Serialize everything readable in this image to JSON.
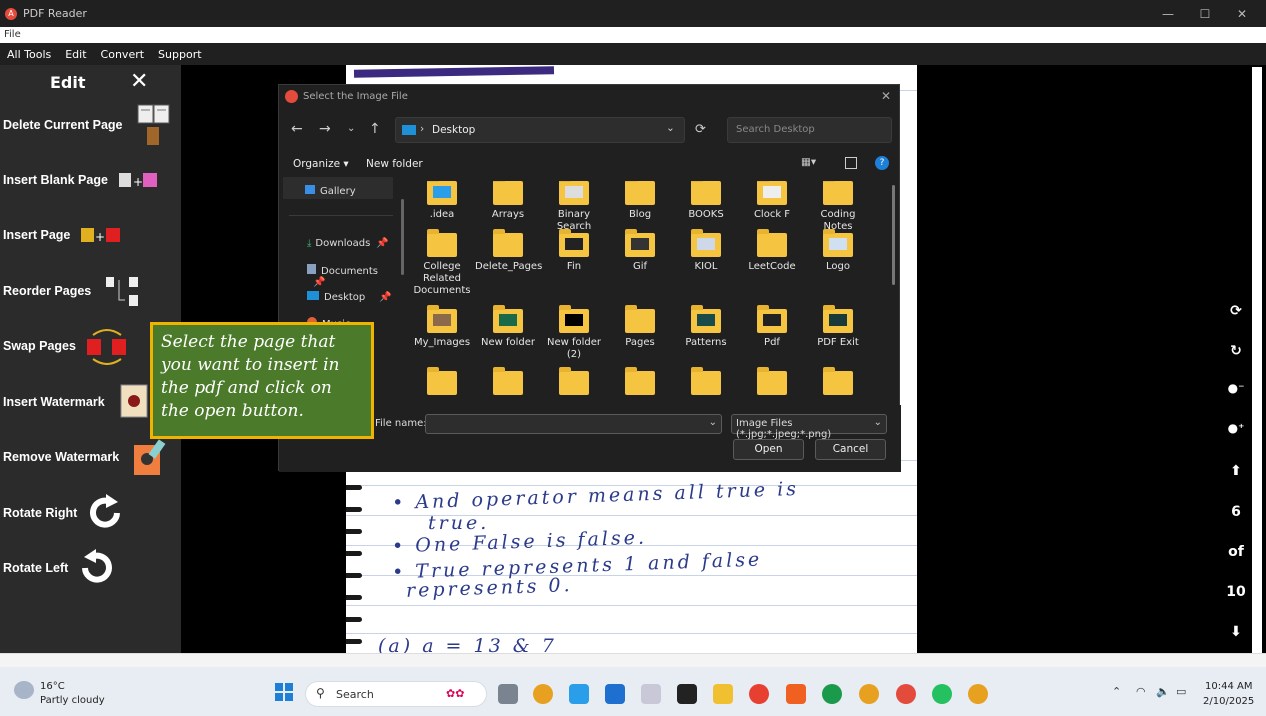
{
  "window": {
    "title": "PDF Reader",
    "minimize": "—",
    "maximize": "☐",
    "close": "✕"
  },
  "filebar": {
    "label": "File"
  },
  "menu": [
    "All Tools",
    "Edit",
    "Convert",
    "Support"
  ],
  "edit_panel": {
    "title": "Edit",
    "close": "✕",
    "tools": [
      "Delete Current Page",
      "Insert Blank Page",
      "Insert Page",
      "Reorder Pages",
      "Swap Pages",
      "Insert Watermark",
      "Remove Watermark",
      "Rotate Right",
      "Rotate Left"
    ]
  },
  "right_toolbar": {
    "page_current": "6",
    "page_of": "of",
    "page_total": "10"
  },
  "dialog": {
    "title": "Select the Image File",
    "location": "Desktop",
    "search_placeholder": "Search Desktop",
    "organize": "Organize ▾",
    "new_folder": "New folder",
    "nav": [
      {
        "label": "Gallery",
        "icon": "gallery-icon"
      },
      {
        "label": "Downloads",
        "icon": "download-icon"
      },
      {
        "label": "Documents",
        "icon": "documents-icon"
      },
      {
        "label": "Desktop",
        "icon": "desktop-icon"
      },
      {
        "label": "Music",
        "icon": "music-icon"
      }
    ],
    "items": [
      ".idea",
      "Arrays",
      "Binary Search",
      "Blog",
      "BOOKS",
      "Clock F",
      "Coding Notes",
      "College Related Documents",
      "Delete_Pages",
      "Fin",
      "Gif",
      "KIOL",
      "LeetCode",
      "Logo",
      "My_Images",
      "New folder",
      "New folder (2)",
      "Pages",
      "Patterns",
      "Pdf",
      "PDF Exit"
    ],
    "file_name_label": "File name:",
    "file_name_value": "",
    "file_type": "Image Files (*.jpg;*.jpeg;*.png)",
    "open_button": "Open",
    "cancel_button": "Cancel"
  },
  "callout": {
    "text": "Select the page that you want to insert in the pdf and click on the open button."
  },
  "notebook_text": [
    "• And operator means all true is",
    "true.",
    "• One False is false.",
    "• True represents 1 and false",
    "represents 0.",
    "(a)   a = 13 & 7"
  ],
  "taskbar": {
    "weather_temp": "16°C",
    "weather_desc": "Partly cloudy",
    "search": "Search",
    "time": "10:44 AM",
    "date": "2/10/2025"
  }
}
